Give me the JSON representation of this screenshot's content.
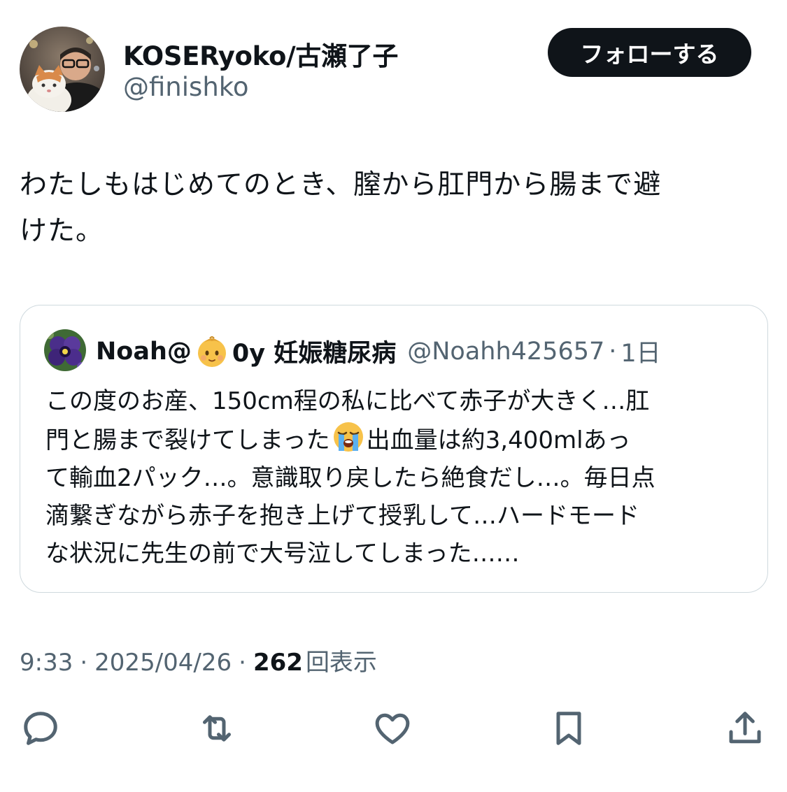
{
  "author": {
    "display_name": "KOSERyoko/古瀬了子",
    "handle": "@finishko",
    "avatar_icon": "user-avatar-with-cat"
  },
  "follow_button": {
    "label": "フォローする"
  },
  "tweet": {
    "text_line1": "わたしもはじめてのとき、膣から肛門から腸まで避",
    "text_line2": "けた。"
  },
  "quote": {
    "name_prefix": "Noah@",
    "name_emoji": "baby-emoji",
    "name_suffix": "0y 妊娠糖尿病",
    "handle": "@Noahh425657",
    "dot": "·",
    "time": "1日",
    "body_line1": "この度のお産、150cm程の私に比べて赤子が大きく…肛",
    "body_line2a": "門と腸まで裂けてしまった",
    "body_emoji": "loudly-crying-face-emoji",
    "body_line2b": "出血量は約3,400mlあっ",
    "body_line3": "て輸血2パック…。意識取り戻したら絶食だし…。毎日点",
    "body_line4": "滴繋ぎながら赤子を抱き上げて授乳して…ハードモード",
    "body_line5": "な状況に先生の前で大号泣してしまった……"
  },
  "meta": {
    "time": "9:33",
    "sep1": "·",
    "date": "2025/04/26",
    "sep2": "·",
    "views_count": "262",
    "views_label": "回表示"
  },
  "actions": [
    "reply-icon",
    "retweet-icon",
    "like-icon",
    "bookmark-icon",
    "share-icon"
  ],
  "colors": {
    "text": "#0f1419",
    "secondary": "#536471",
    "border": "#cfd9de",
    "button_bg": "#0f1419"
  }
}
